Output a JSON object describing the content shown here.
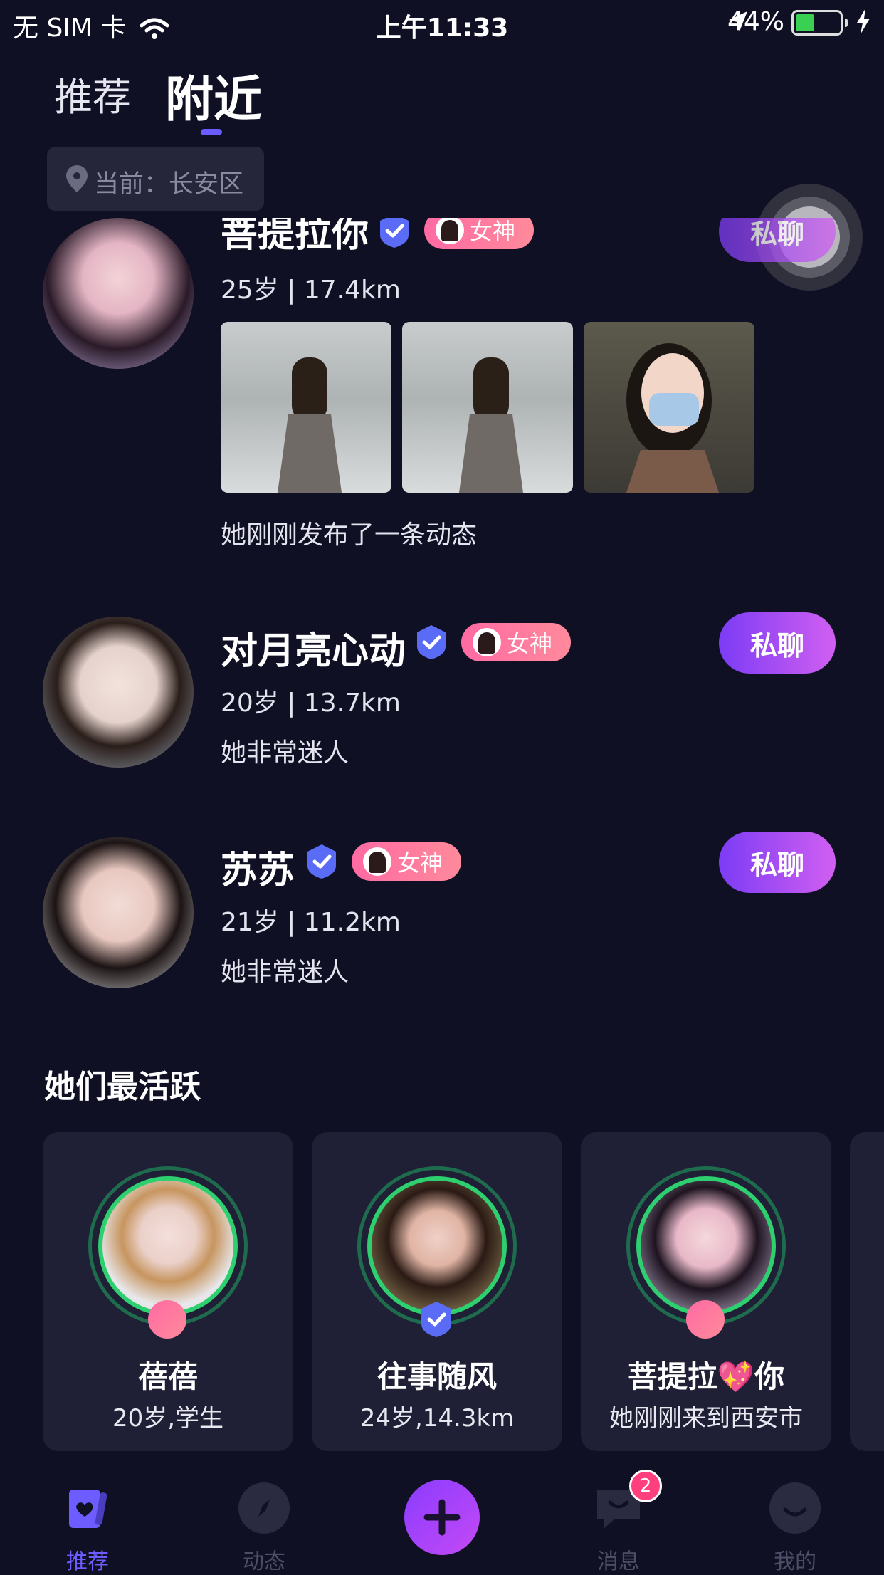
{
  "status_bar": {
    "carrier": "无 SIM 卡",
    "time": "上午11:33",
    "battery": "44%"
  },
  "tabs": {
    "recommend": "推荐",
    "nearby": "附近"
  },
  "location": {
    "text": "当前：长安区"
  },
  "chat_label": "私聊",
  "goddess_label": "女神",
  "users": [
    {
      "name": "菩提拉你",
      "meta": "25岁 | 17.4km",
      "desc": "她刚刚发布了一条动态"
    },
    {
      "name": "对月亮心动",
      "meta": "20岁 | 13.7km",
      "desc": "她非常迷人"
    },
    {
      "name": "苏苏",
      "meta": "21岁 | 11.2km",
      "desc": "她非常迷人"
    }
  ],
  "active_section": {
    "title": "她们最活跃",
    "cards": [
      {
        "name": "蓓蓓",
        "info": "20岁,学生"
      },
      {
        "name": "往事随风",
        "info": "24岁,14.3km"
      },
      {
        "name": "菩提拉💖你",
        "info": "她刚刚来到西安市"
      }
    ]
  },
  "nav": {
    "items": [
      {
        "label": "推荐",
        "icon": "heart-card-icon"
      },
      {
        "label": "动态",
        "icon": "compass-icon"
      },
      {
        "label": "消息",
        "icon": "message-icon"
      },
      {
        "label": "我的",
        "icon": "smile-icon"
      }
    ],
    "message_badge": "2"
  },
  "colors": {
    "background": "#101025",
    "accent": "#6d5cff",
    "chat_gradient_start": "#7c3cf5",
    "chat_gradient_end": "#d15ff1",
    "goddess_pink": "#ff6aa3",
    "active_ring": "#2ecf6f"
  }
}
